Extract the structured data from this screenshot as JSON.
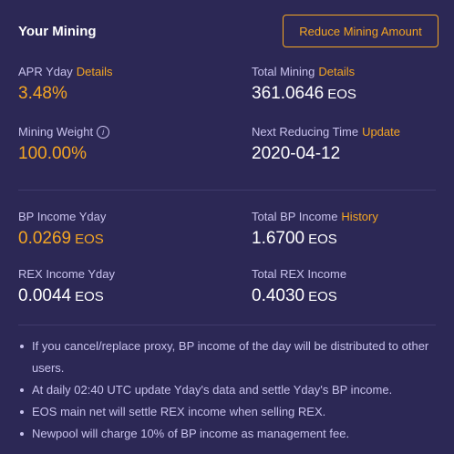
{
  "header": {
    "title": "Your Mining",
    "reduce_button": "Reduce Mining Amount"
  },
  "stats": {
    "apr": {
      "label": "APR Yday",
      "link": "Details",
      "value": "3.48%"
    },
    "total_mining": {
      "label": "Total Mining",
      "link": "Details",
      "value": "361.0646",
      "unit": "EOS"
    },
    "mining_weight": {
      "label": "Mining Weight",
      "icon": "info-icon",
      "value": "100.00%"
    },
    "next_reducing": {
      "label": "Next Reducing Time",
      "link": "Update",
      "value": "2020-04-12"
    },
    "bp_income": {
      "label": "BP Income Yday",
      "value": "0.0269",
      "unit": "EOS"
    },
    "total_bp_income": {
      "label": "Total BP Income",
      "link": "History",
      "value": "1.6700",
      "unit": "EOS"
    },
    "rex_income": {
      "label": "REX Income Yday",
      "value": "0.0044",
      "unit": "EOS"
    },
    "total_rex_income": {
      "label": "Total REX Income",
      "value": "0.4030",
      "unit": "EOS"
    }
  },
  "notes": [
    "If you cancel/replace proxy, BP income of the day will be distributed to other users.",
    "At daily 02:40 UTC update Yday's data and settle Yday's BP income.",
    "EOS main net will settle REX income when selling REX.",
    "Newpool will charge 10% of BP income as management fee."
  ],
  "colors": {
    "background": "#2c2855",
    "accent": "#f5a623",
    "label": "#c9c3ee"
  }
}
